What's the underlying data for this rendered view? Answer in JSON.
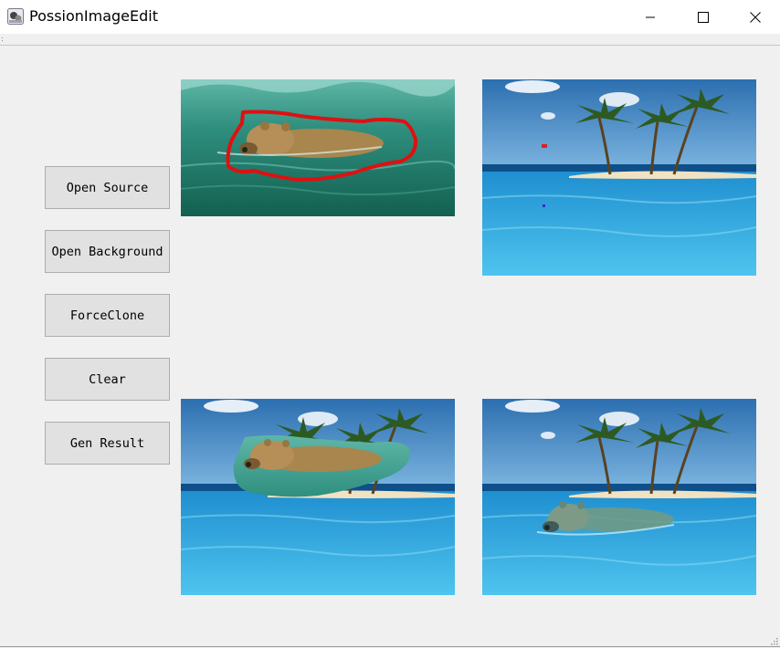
{
  "window": {
    "title": "PossionImageEdit",
    "controls": {
      "minimize": "minimize-icon",
      "maximize": "maximize-icon",
      "close": "close-icon"
    }
  },
  "buttons": {
    "open_source": "Open Source",
    "open_background": "Open Background",
    "force_clone": "ForceClone",
    "clear": "Clear",
    "gen_result": "Gen Result"
  },
  "panels": {
    "source": "source-image-with-red-outline-of-bear-in-water",
    "background": "background-image-tropical-island-with-palm-trees",
    "clone_preview": "forced-clone-preview-bear-pasted-on-background",
    "result": "poisson-blended-result-bear-swimming-near-island"
  },
  "colors": {
    "selection_stroke": "#e01010",
    "background_marker_red": "#e02020",
    "background_marker_blue": "#3030d0"
  }
}
